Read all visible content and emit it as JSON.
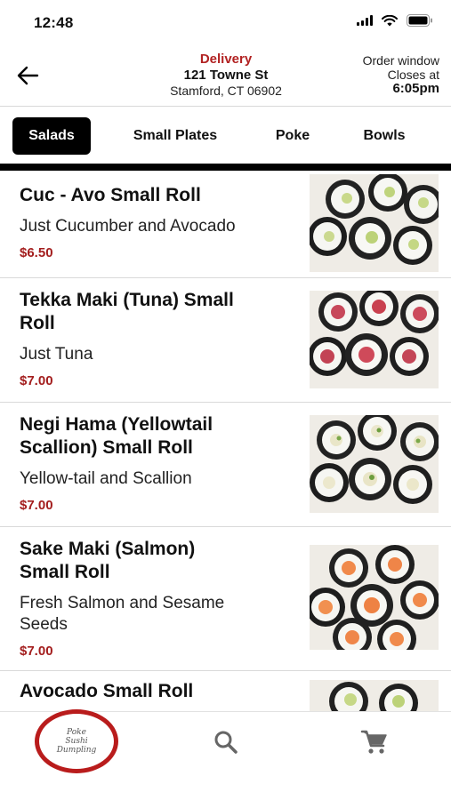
{
  "status_bar": {
    "time": "12:48"
  },
  "header": {
    "back_icon": "arrow-left-icon",
    "delivery_label": "Delivery",
    "street": "121 Towne St",
    "city": "Stamford, CT 06902",
    "order_window_line1": "Order window",
    "order_window_line2": "Closes at",
    "order_window_time": "6:05pm"
  },
  "tabs": [
    {
      "label": "Salads",
      "active": true
    },
    {
      "label": "Small Plates",
      "active": false
    },
    {
      "label": "Poke",
      "active": false
    },
    {
      "label": "Bowls",
      "active": false
    }
  ],
  "menu_items": [
    {
      "name_lines": [
        "Cuc - Avo Small Roll"
      ],
      "desc_lines": [
        "Just Cucumber and Avocado"
      ],
      "price": "$6.50",
      "image": "cucumber-avocado-roll"
    },
    {
      "name_lines": [
        "Tekka Maki (Tuna) Small",
        "Roll"
      ],
      "desc_lines": [
        "Just Tuna"
      ],
      "price": "$7.00",
      "image": "tuna-roll"
    },
    {
      "name_lines": [
        "Negi Hama (Yellowtail",
        "Scallion) Small Roll"
      ],
      "desc_lines": [
        "Yellow-tail and Scallion"
      ],
      "price": "$7.00",
      "image": "yellowtail-scallion-roll"
    },
    {
      "name_lines": [
        "Sake Maki (Salmon)",
        "Small Roll"
      ],
      "desc_lines": [
        "Fresh Salmon and Sesame",
        "Seeds"
      ],
      "price": "$7.00",
      "image": "salmon-roll"
    },
    {
      "name_lines": [
        "Avocado Small Roll"
      ],
      "desc_lines": [],
      "price": "",
      "image": "avocado-roll"
    }
  ],
  "bottom_nav": {
    "logo_line1": "Poke",
    "logo_line2": "Sushi",
    "logo_line3": "Dumpling",
    "search_icon": "search-icon",
    "cart_icon": "cart-icon"
  },
  "colors": {
    "accent_red": "#b22222",
    "price_red": "#a31d1d",
    "active_tab_bg": "#000000"
  }
}
